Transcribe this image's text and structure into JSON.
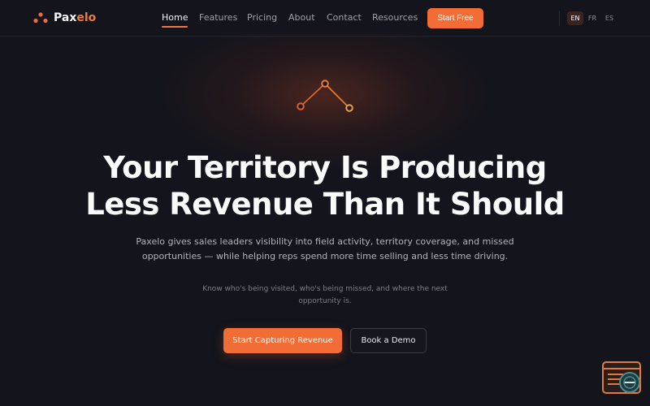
{
  "brand": {
    "name_main": "Pax",
    "name_accent": "elo",
    "logo_icon": "three-dots-logo-icon",
    "accent_color": "#f26d35"
  },
  "nav": {
    "links": [
      "Home",
      "Features",
      "Pricing",
      "About",
      "Contact",
      "Resources"
    ],
    "active": "Home",
    "cta_label": "Start Free",
    "languages": [
      "EN",
      "FR",
      "ES"
    ],
    "active_language": "EN"
  },
  "hero": {
    "icon": "connected-nodes-icon",
    "headline_line1": "Your Territory Is Producing",
    "headline_line2": "Less Revenue Than It Should",
    "subheadline": "Paxelo gives sales leaders visibility into field activity, territory coverage, and missed opportunities — while helping reps spend more time selling and less time driving.",
    "supporting_text": "Know who's being visited, who's being missed, and where the next opportunity is.",
    "primary_cta": "Start Capturing Revenue",
    "secondary_cta": "Book a Demo"
  },
  "widget": {
    "icon": "chat-support-icon"
  }
}
